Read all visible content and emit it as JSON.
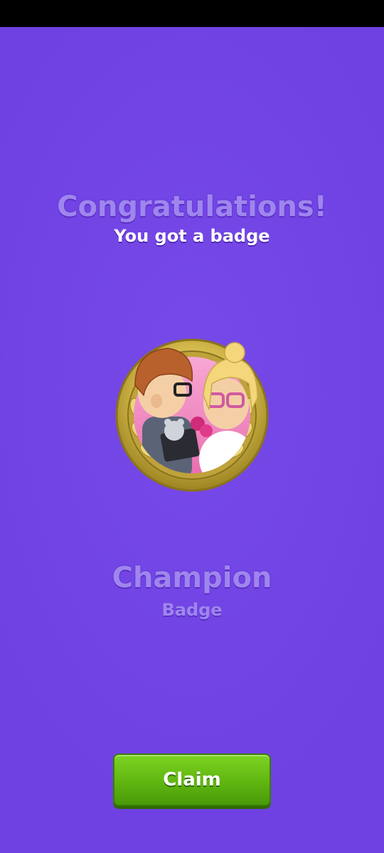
{
  "reward": {
    "title": "Congratulations!",
    "subtitle": "You got a badge",
    "badge_name": "Champion",
    "badge_type": "Badge",
    "claim_label": "Claim"
  },
  "colors": {
    "background": "#6f41e2",
    "title_text": "#9f86ee",
    "button_green": "#5fb611",
    "medal_gold": "#d8c15a"
  },
  "icons": {
    "badge": "couple-medal-icon"
  }
}
